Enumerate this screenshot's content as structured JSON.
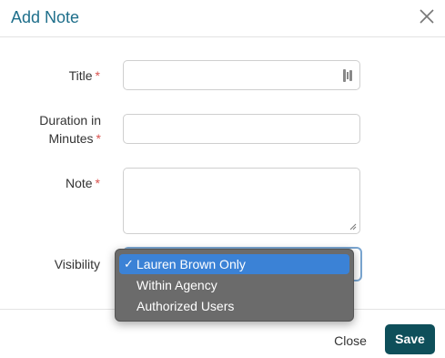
{
  "dialog": {
    "title": "Add Note",
    "close_icon": "close-icon"
  },
  "form": {
    "title_label": "Title",
    "title_value": "",
    "duration_label_line1": "Duration in",
    "duration_label_line2": "Minutes",
    "duration_value": "",
    "note_label": "Note",
    "note_value": "",
    "visibility_label": "Visibility",
    "required_marker": "*",
    "visibility_options": [
      {
        "label": "Lauren Brown Only",
        "selected": true
      },
      {
        "label": "Within Agency",
        "selected": false
      },
      {
        "label": "Authorized Users",
        "selected": false
      }
    ]
  },
  "footer": {
    "close_label": "Close",
    "save_label": "Save"
  },
  "colors": {
    "title": "#1f6f8b",
    "save_button": "#0e4f5a",
    "required": "#d9534f",
    "dropdown_bg": "#6b6b6b",
    "dropdown_selected": "#3b82d6"
  }
}
